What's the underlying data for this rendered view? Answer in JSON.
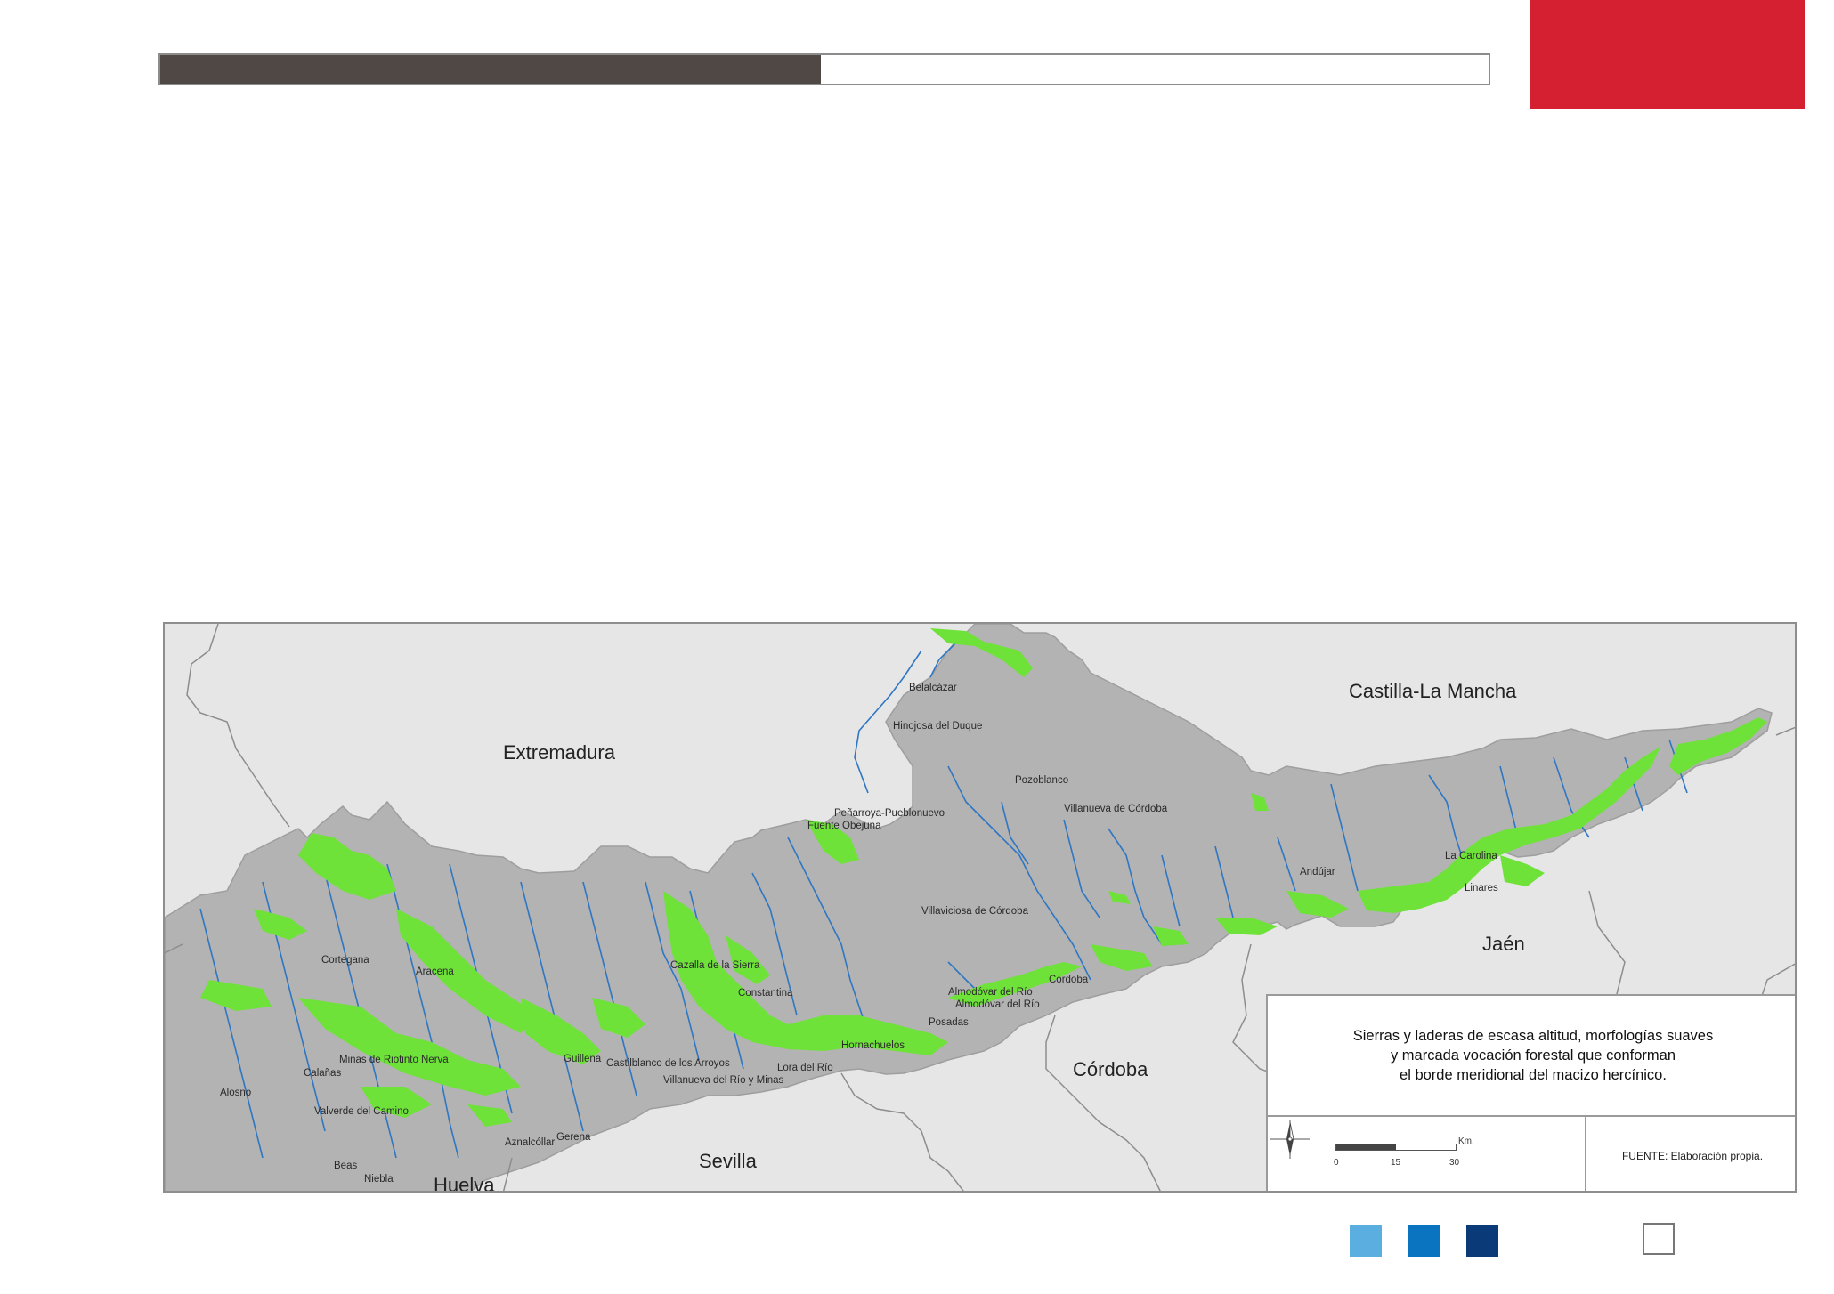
{
  "header": {
    "progress_fraction": 0.497,
    "progress_color": "#4f4844",
    "accent_color": "#d42030"
  },
  "map": {
    "regions": {
      "extremadura": "Extremadura",
      "castilla": "Castilla-La Mancha",
      "jaen": "Jaén",
      "cordoba": "Córdoba",
      "sevilla": "Sevilla",
      "huelva": "Huelva"
    },
    "towns": {
      "belalcazar": "Belalcázar",
      "hinojosa": "Hinojosa del Duque",
      "pozoblanco": "Pozoblanco",
      "villanueva_cordoba": "Villanueva de Córdoba",
      "penarroya": "Peñarroya-Pueblonuevo",
      "fuente_obejuna": "Fuente Obejuna",
      "la_carolina": "La Carolina",
      "andujar": "Andújar",
      "linares": "Linares",
      "villaviciosa": "Villaviciosa de Córdoba",
      "cortegana": "Cortegana",
      "aracena": "Aracena",
      "cazalla": "Cazalla de la Sierra",
      "constantina": "Constantina",
      "almodovar1": "Almodóvar del Río",
      "almodovar2": "Almodóvar del Río",
      "cordoba_city": "Córdoba",
      "posadas": "Posadas",
      "hornachuelos": "Hornachuelos",
      "minas_riotinto": "Minas de Riotinto",
      "nerva": "Nerva",
      "calanas": "Calañas",
      "guillena": "Guillena",
      "castilblanco": "Castilblanco de los Arroyos",
      "lora": "Lora del Río",
      "villanueva_minas": "Villanueva del Río y Minas",
      "alosno": "Alosno",
      "valverde": "Valverde del Camino",
      "aznalcollar": "Aznalcóllar",
      "gerena": "Gerena",
      "beas": "Beas",
      "niebla": "Niebla"
    },
    "colors": {
      "relief": "#b3b3b3",
      "highlight": "#6fe23a",
      "rivers": "#2f77c2",
      "background": "#e6e6e6",
      "border": "#8d8d8d"
    }
  },
  "legend": {
    "description_lines": [
      "Sierras y laderas de escasa altitud, morfologías suaves",
      "y marcada vocación forestal que conforman",
      "el borde meridional del macizo hercínico."
    ],
    "scale_unit": "Km.",
    "scale_ticks": [
      "0",
      "15",
      "30"
    ],
    "compass_icon": "north-arrow-icon",
    "source": "FUENTE: Elaboración propia."
  },
  "footer": {
    "swatch_colors": [
      "#5aaee0",
      "#0b74c0",
      "#0a3a78"
    ]
  }
}
